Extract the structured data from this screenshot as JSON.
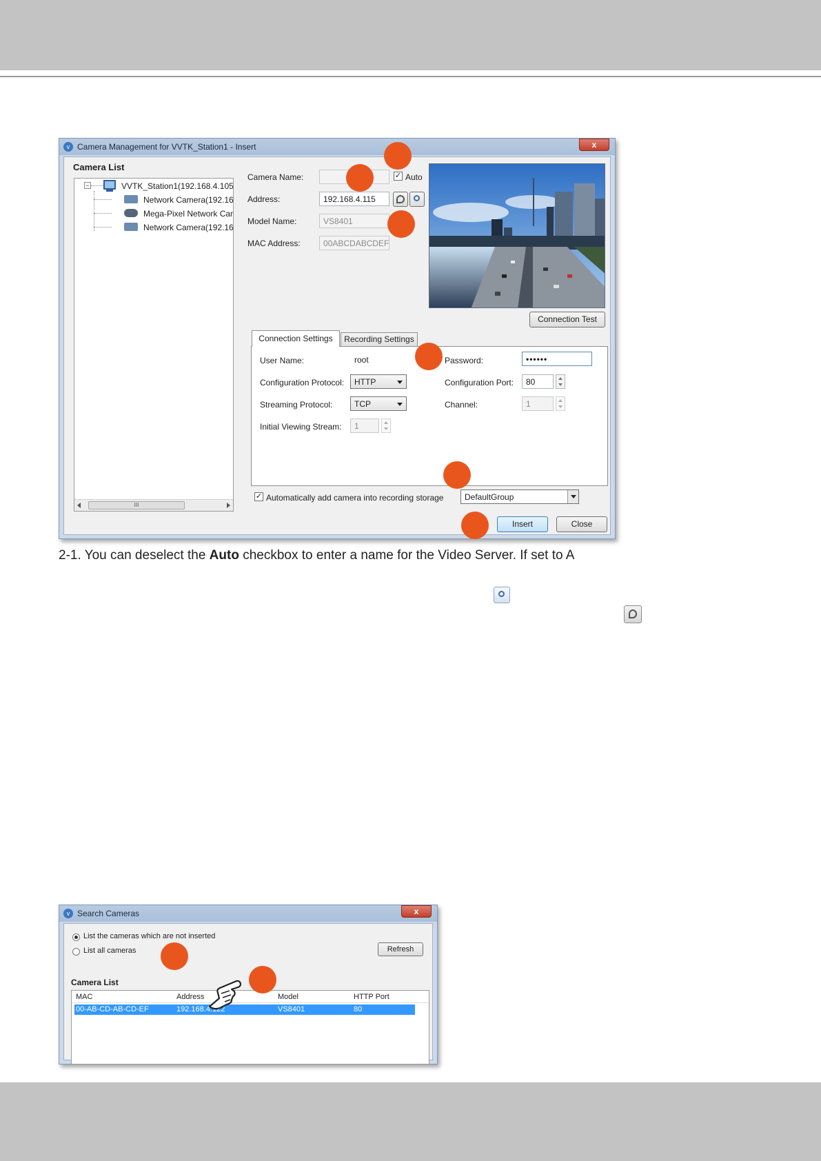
{
  "main_window": {
    "title": "Camera Management for VVTK_Station1 - Insert",
    "close_glyph": "x",
    "camera_list_heading": "Camera List",
    "tree": {
      "root": "VVTK_Station1(192.168.4.105",
      "children": [
        "Network Camera(192.168",
        "Mega-Pixel Network Came",
        "Network Camera(192.168"
      ]
    },
    "scroll_thumb_glyph": "III",
    "camera_name_label": "Camera Name:",
    "camera_name_value": "",
    "auto_label": "Auto",
    "address_label": "Address:",
    "address_value": "192.168.4.115",
    "model_name_label": "Model Name:",
    "model_name_value": "VS8401",
    "mac_address_label": "MAC Address:",
    "mac_address_value": "00ABCDABCDEF",
    "connection_test_label": "Connection Test",
    "tabs": [
      "Connection Settings",
      "Recording Settings"
    ],
    "connection": {
      "user_name_label": "User Name:",
      "user_name_value": "root",
      "password_label": "Password:",
      "password_value": "••••••",
      "config_protocol_label": "Configuration Protocol:",
      "config_protocol_value": "HTTP",
      "config_port_label": "Configuration Port:",
      "config_port_value": "80",
      "streaming_protocol_label": "Streaming Protocol:",
      "streaming_protocol_value": "TCP",
      "channel_label": "Channel:",
      "channel_value": "1",
      "initial_stream_label": "Initial Viewing Stream:",
      "initial_stream_value": "1"
    },
    "auto_add_label": "Automatically add camera into recording storage",
    "group_value": "DefaultGroup",
    "insert_label": "Insert",
    "close_label": "Close"
  },
  "body_text": {
    "step_prefix": "2-1. You can deselect the ",
    "step_bold": "Auto",
    "step_suffix": " checkbox to enter a name for the Video Server. If set to A"
  },
  "search_window": {
    "title": "Search Cameras",
    "close_glyph": "x",
    "option_not_inserted": "List the cameras which are not inserted",
    "option_all": "List all cameras",
    "refresh_label": "Refresh",
    "camera_list_heading": "Camera List",
    "columns": [
      "MAC",
      "Address",
      "Model",
      "HTTP Port"
    ],
    "rows": [
      [
        "00-AB-CD-AB-CD-EF",
        "192.168.4.122",
        "VS8401",
        "80"
      ]
    ]
  },
  "colors": {
    "marker": "#e8561e",
    "selection": "#3399ff",
    "band": "#c3c3c3"
  },
  "icons": [
    "search-magnifier-icon",
    "network-cable-icon",
    "pointing-hand-icon",
    "computer-icon",
    "camera-icon"
  ]
}
